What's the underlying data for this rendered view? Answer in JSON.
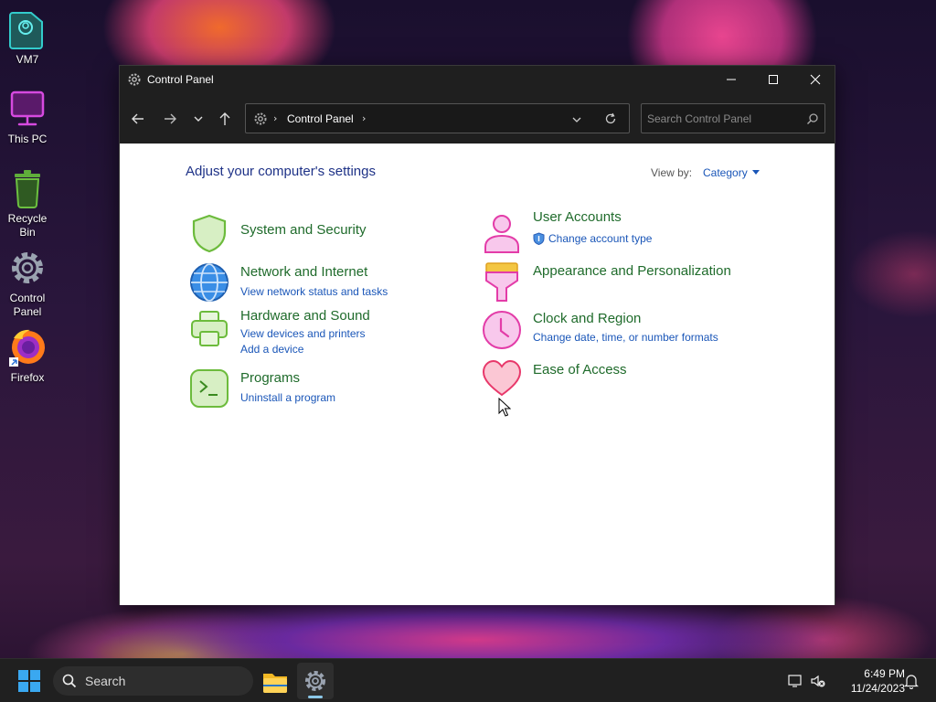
{
  "desktop": {
    "icons": [
      {
        "label": "VM7",
        "icon": "user-folder-icon"
      },
      {
        "label": "This PC",
        "icon": "monitor-icon"
      },
      {
        "label": "Recycle\nBin",
        "icon": "recycle-bin-icon"
      },
      {
        "label": "Control\nPanel",
        "icon": "gear-icon"
      },
      {
        "label": "Firefox",
        "icon": "firefox-icon"
      }
    ]
  },
  "window": {
    "title": "Control Panel",
    "address": {
      "crumb": "Control Panel"
    },
    "search": {
      "placeholder": "Search Control Panel"
    },
    "heading": "Adjust your computer's settings",
    "view_by": {
      "label": "View by:",
      "value": "Category"
    },
    "categories_left": [
      {
        "title": "System and Security",
        "icon": "shield-icon",
        "links": []
      },
      {
        "title": "Network and Internet",
        "icon": "globe-icon",
        "links": [
          "View network status and tasks"
        ]
      },
      {
        "title": "Hardware and Sound",
        "icon": "printer-icon",
        "links": [
          "View devices and printers",
          "Add a device"
        ]
      },
      {
        "title": "Programs",
        "icon": "terminal-icon",
        "links": [
          "Uninstall a program"
        ]
      }
    ],
    "categories_right": [
      {
        "title": "User Accounts",
        "icon": "user-icon",
        "links": [
          "Change account type"
        ]
      },
      {
        "title": "Appearance and Personalization",
        "icon": "paint-brush-icon",
        "links": []
      },
      {
        "title": "Clock and Region",
        "icon": "clock-icon",
        "links": [
          "Change date, time, or number formats"
        ]
      },
      {
        "title": "Ease of Access",
        "icon": "heart-icon",
        "links": []
      }
    ]
  },
  "taskbar": {
    "search_label": "Search",
    "time": "6:49 PM",
    "date": "11/24/2023"
  },
  "colors": {
    "category_title": "#1f6b2b",
    "link": "#1a56b8",
    "heading": "#1e3287",
    "titlebar": "#1f1f1f"
  }
}
